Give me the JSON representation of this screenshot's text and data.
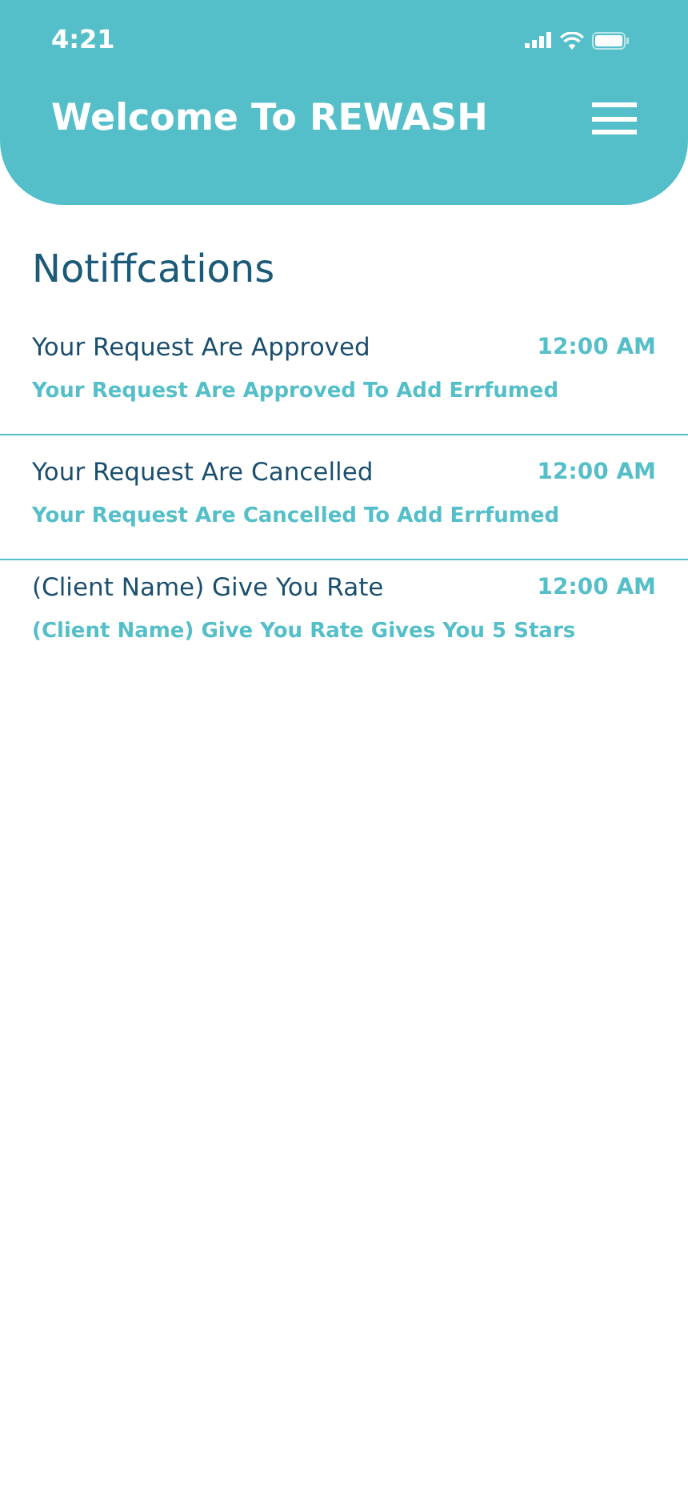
{
  "status_bar": {
    "time": "4:21"
  },
  "header": {
    "title": "Welcome To REWASH"
  },
  "section_title": "Notiffcations",
  "notifications": [
    {
      "title": "Your Request Are Approved",
      "time": "12:00 AM",
      "body": "Your Request Are Approved To Add Errfumed"
    },
    {
      "title": "Your Request Are Cancelled",
      "time": "12:00 AM",
      "body": "Your Request Are Cancelled To Add Errfumed"
    },
    {
      "title": "(Client Name) Give You Rate",
      "time": "12:00 AM",
      "body": "(Client Name) Give You Rate Gives You 5 Stars"
    }
  ]
}
